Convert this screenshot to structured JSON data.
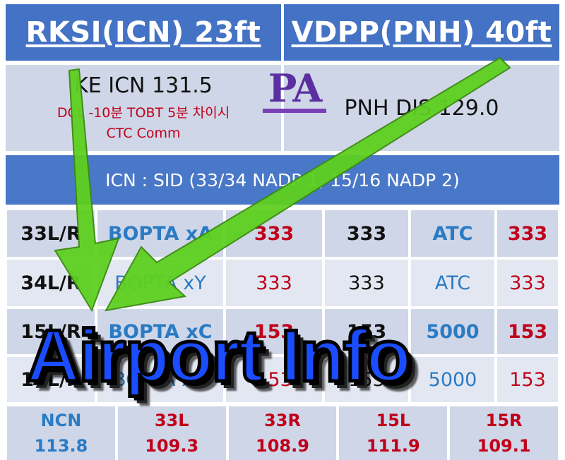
{
  "header": {
    "left_title": "RKSI(ICN) 23ft",
    "right_title": "VDPP(PNH) 40ft"
  },
  "info": {
    "left_freq": "KE ICN 131.5",
    "left_note_1": "DCL -10분 TOBT 5분 차이시",
    "left_note_2": "CTC Comm",
    "right_freq": "PNH DIS 129.0"
  },
  "logo": {
    "text": "PA"
  },
  "sid_banner": "ICN : SID (33/34 NADP 1, 15/16 NADP 2)",
  "runway_rows": [
    {
      "runway": "33L/R",
      "sid": "BOPTA xA",
      "v1": "333",
      "v2": "333",
      "ctrl": "ATC",
      "v3": "333"
    },
    {
      "runway": "34L/R",
      "sid": "BOPTA xY",
      "v1": "333",
      "v2": "333",
      "ctrl": "ATC",
      "v3": "333"
    },
    {
      "runway": "15L/R",
      "sid": "BOPTA xC",
      "v1": "153",
      "v2": "153",
      "ctrl": "5000",
      "v3": "153"
    },
    {
      "runway": "16L/R",
      "sid": "BOPTA xD",
      "v1": "153",
      "v2": "153",
      "ctrl": "5000",
      "v3": "153"
    }
  ],
  "freq_table": [
    {
      "name": "NCN",
      "value": "113.8"
    },
    {
      "name": "33L",
      "value": "109.3"
    },
    {
      "name": "33R",
      "value": "108.9"
    },
    {
      "name": "15L",
      "value": "111.9"
    },
    {
      "name": "15R",
      "value": "109.1"
    }
  ],
  "overlay_title": "Airport Info",
  "colors": {
    "header_blue": "#4472c4",
    "text_red": "#c0001a",
    "text_blue": "#2b7bc4",
    "arrow_green": "#5ed020"
  }
}
